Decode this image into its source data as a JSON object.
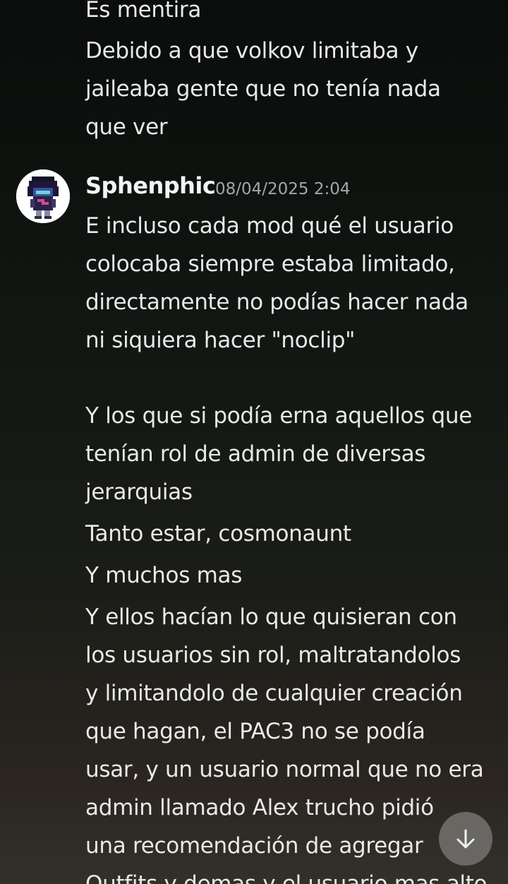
{
  "previous_message": {
    "lines": [
      "Es mentira",
      "Debido a que volkov limitaba y",
      "jaileaba gente que no tenía nada",
      "que ver"
    ]
  },
  "message": {
    "username": "Sphenphic",
    "timestamp": "08/04/2025 2:04",
    "avatar_icon": "pixel-character-avatar-icon",
    "lines": [
      "E incluso cada mod qué el usuario",
      "colocaba siempre estaba limitado,",
      "directamente no podías hacer nada",
      "ni siquiera hacer \"noclip\"",
      "Y los que si podía erna aquellos que",
      "tenían rol de admin de diversas",
      "jerarquias",
      "Tanto estar, cosmonaunt",
      "Y muchos mas",
      "Y ellos hacían lo que quisieran con",
      "los usuarios sin rol, maltratandolos",
      "y limitandolo de cualquier creación",
      "que hagan, el PAC3 no se podía",
      "usar, y un usuario normal que no era",
      "admin llamado Alex trucho pidió",
      "una recomendación de agregar",
      "Outfits y demas y el usuario mas alto"
    ]
  },
  "scroll_button": {
    "icon": "arrow-down-icon"
  }
}
